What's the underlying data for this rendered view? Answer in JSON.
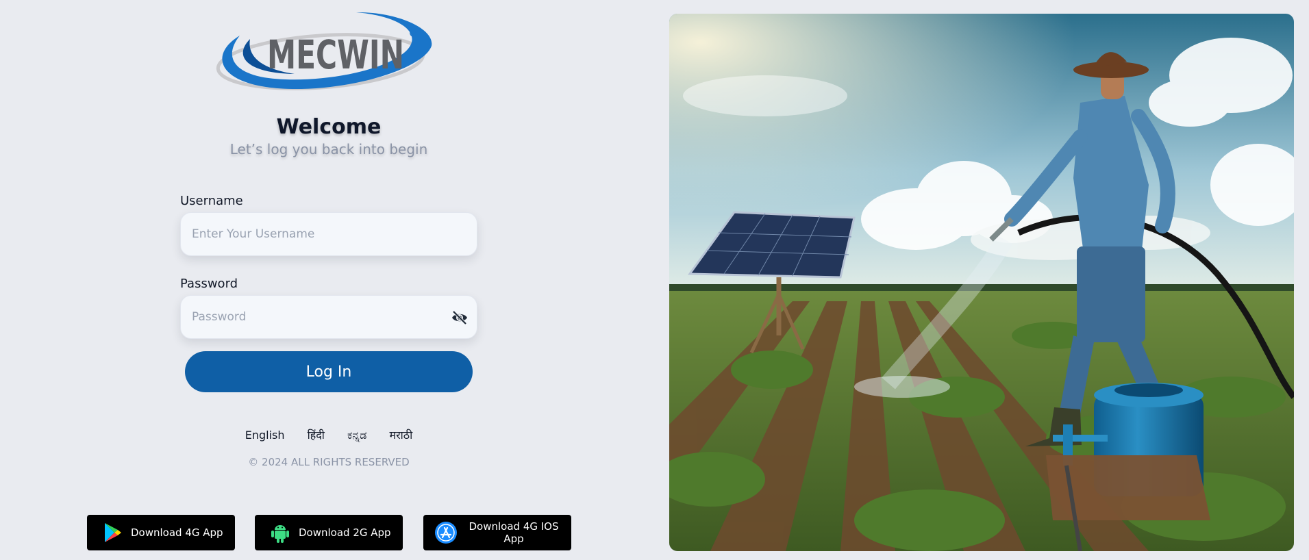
{
  "brand": {
    "name": "MECWIN",
    "registered": "®"
  },
  "header": {
    "title": "Welcome",
    "subtitle": "Let’s log you back into begin"
  },
  "form": {
    "username_label": "Username",
    "username_placeholder": "Enter Your Username",
    "username_value": "",
    "password_label": "Password",
    "password_placeholder": "Password",
    "password_value": "",
    "password_visibility_icon": "eye-slash-icon",
    "login_label": "Log In"
  },
  "languages": [
    "English",
    "हिंदी",
    "ಕನ್ನಡ",
    "मराठी"
  ],
  "copyright": "© 2024 ALL RIGHTS RESERVED",
  "downloads": [
    {
      "label": "Download 4G App",
      "icon": "google-play-icon"
    },
    {
      "label": "Download 2G App",
      "icon": "android-icon"
    },
    {
      "label": "Download 4G IOS App",
      "icon": "app-store-icon"
    }
  ],
  "colors": {
    "background": "#e9ebf0",
    "primary": "#0f5fa6",
    "logo_blue": "#1a75c9",
    "logo_text": "#5f6166",
    "muted_text": "#8a93a6"
  }
}
